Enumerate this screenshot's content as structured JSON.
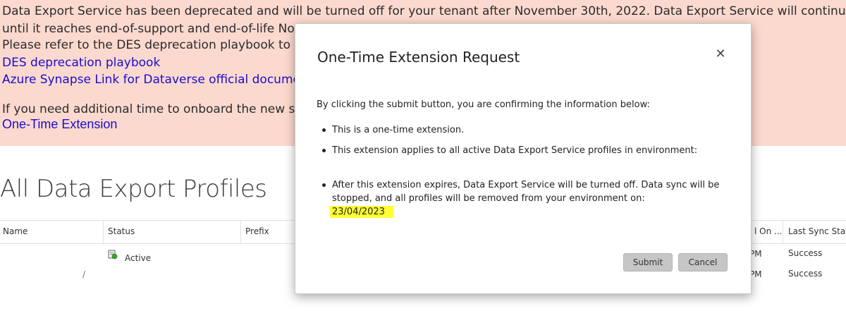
{
  "banner": {
    "line1": "Data Export Service has been deprecated and will be turned off for your tenant after November 30th, 2022. Data Export Service will continue to wo",
    "line2": "until it reaches end-of-support and end-of-life Nov",
    "line3": "Please refer to the DES deprecation playbook to or",
    "link_playbook": "DES deprecation playbook",
    "link_synapse": "Azure Synapse Link for Dataverse official document",
    "line_additional": "If you need additional time to onboard the new sol",
    "link_extension": "One-Time Extension",
    "colors": {
      "background": "#fcd9cf",
      "link": "#1a0dcc"
    }
  },
  "page": {
    "title": "All Data Export Profiles"
  },
  "grid": {
    "columns": {
      "name": "Name",
      "status": "Status",
      "prefix": "Prefix",
      "modified_on": "l On ...",
      "last_sync": "Last Sync Statu"
    },
    "rows": [
      {
        "status": "Active",
        "modified_on": "PM",
        "last_sync": "Success",
        "status_icon": "profile-active-icon"
      },
      {
        "name_fragment": "/",
        "modified_on": "PM",
        "last_sync": "Success"
      }
    ]
  },
  "modal": {
    "title": "One-Time Extension Request",
    "close_icon": "close-icon",
    "intro": "By clicking the submit button, you are confirming the information below:",
    "bullet1": "This is a one-time extension.",
    "bullet2": "This extension applies to all active Data Export Service profiles in environment:",
    "bullet3": "After this extension expires, Data Export Service will be turned off. Data sync will be stopped, and all profiles will be removed from your environment on:",
    "expiry_date": "23/04/2023",
    "submit_label": "Submit",
    "cancel_label": "Cancel",
    "highlight_color": "#ffff33"
  }
}
